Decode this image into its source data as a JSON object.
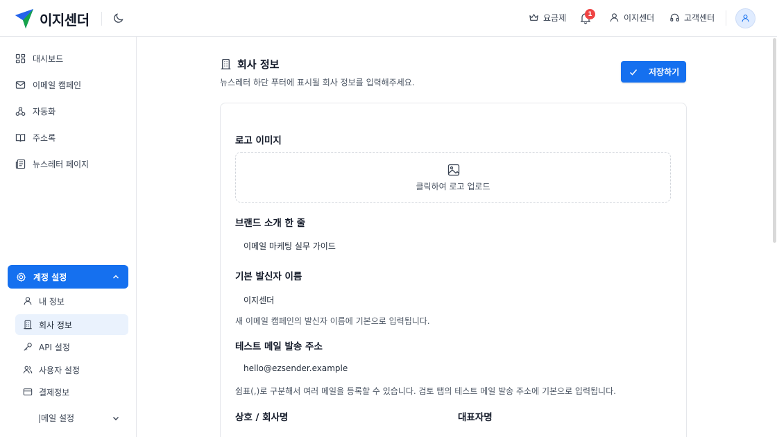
{
  "header": {
    "brand": "이지센더",
    "pricing": "요금제",
    "notification_count": "1",
    "account_name": "이지센더",
    "support": "고객센터"
  },
  "sidebar": {
    "items": [
      {
        "label": "대시보드",
        "icon": "dashboard-icon"
      },
      {
        "label": "이메일 캠페인",
        "icon": "mail-icon"
      },
      {
        "label": "자동화",
        "icon": "workflow-icon"
      },
      {
        "label": "주소록",
        "icon": "book-icon"
      },
      {
        "label": "뉴스레터 페이지",
        "icon": "newspaper-icon"
      }
    ],
    "account_settings": "계정 설정",
    "sub_items": [
      {
        "label": "내 정보",
        "icon": "user-icon"
      },
      {
        "label": "회사 정보",
        "icon": "building-icon",
        "active": true
      },
      {
        "label": "API 설정",
        "icon": "key-icon"
      },
      {
        "label": "사용자 설정",
        "icon": "users-icon"
      },
      {
        "label": "결제정보",
        "icon": "card-icon"
      },
      {
        "label": "|메일 설정",
        "icon": "chevron-down-icon"
      }
    ]
  },
  "page": {
    "title": "회사 정보",
    "subtitle": "뉴스레터 하단 푸터에 표시될 회사 정보를 입력해주세요.",
    "save_label": "저장하기"
  },
  "form": {
    "logo_label": "로고 이미지",
    "logo_upload_text": "클릭하여 로고 업로드",
    "brand_intro_label": "브랜드 소개 한 줄",
    "brand_intro_value": "이메일 마케팅 실무 가이드",
    "sender_name_label": "기본 발신자 이름",
    "sender_name_value": "이지센더",
    "sender_name_help": "새 이메일 캠페인의 발신자 이름에 기본으로 입력됩니다.",
    "test_email_label": "테스트 메일 발송 주소",
    "test_email_value": "hello@ezsender.example",
    "test_email_help": "쉼표(,)로 구분해서 여러 메일을 등록할 수 있습니다. 검토 탭의 테스트 메일 발송 주소에 기본으로 입력됩니다.",
    "company_name_label": "상호 / 회사명",
    "ceo_name_label": "대표자명"
  },
  "colors": {
    "accent": "#1570ef",
    "active_bg": "#eaf2fd",
    "badge": "#ef4444"
  }
}
